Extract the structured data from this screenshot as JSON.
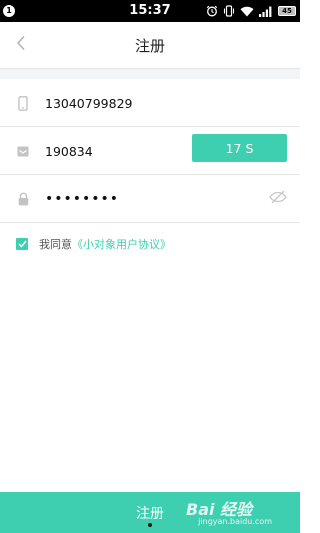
{
  "status_bar": {
    "notification_count": "1",
    "time": "15:37",
    "battery": "45",
    "icons": [
      "alarm-icon",
      "vibrate-icon",
      "wifi-icon",
      "signal-icon",
      "battery-icon"
    ]
  },
  "header": {
    "title": "注册",
    "back_icon": "chevron-left-icon"
  },
  "form": {
    "phone": {
      "icon": "phone-icon",
      "value": "13040799829"
    },
    "code": {
      "icon": "message-icon",
      "value": "190834",
      "button_label": "17 S"
    },
    "password": {
      "icon": "lock-icon",
      "value": "••••••••",
      "toggle_icon": "eye-off-icon"
    }
  },
  "agreement": {
    "checked": true,
    "text": "我同意",
    "link_text": "《小对象用户协议》"
  },
  "footer": {
    "register_label": "注册"
  },
  "watermark": {
    "main": "Bai 经验",
    "sub": "jingyan.baidu.com"
  },
  "colors": {
    "accent": "#3ecfb0",
    "status_bar": "#000000",
    "divider": "#e6e6e6",
    "background": "#ffffff"
  }
}
